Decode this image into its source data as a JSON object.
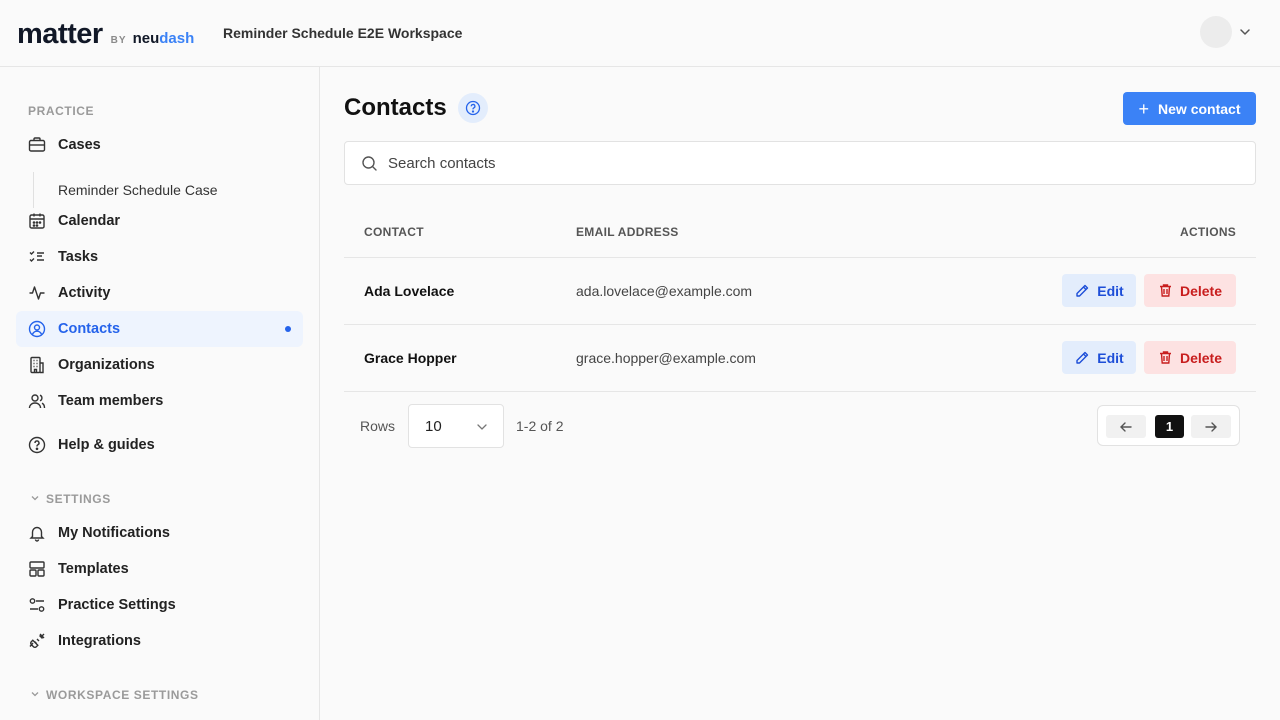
{
  "header": {
    "logo_main": "matter",
    "logo_by": "BY",
    "logo_brand_a": "neu",
    "logo_brand_b": "dash",
    "workspace_name": "Reminder Schedule E2E Workspace"
  },
  "sidebar": {
    "practice_label": "PRACTICE",
    "cases": "Cases",
    "sub_case": "Reminder Schedule Case",
    "calendar": "Calendar",
    "tasks": "Tasks",
    "activity": "Activity",
    "contacts": "Contacts",
    "organizations": "Organizations",
    "team_members": "Team members",
    "help": "Help & guides",
    "settings_label": "SETTINGS",
    "my_notifications": "My Notifications",
    "templates": "Templates",
    "practice_settings": "Practice Settings",
    "integrations": "Integrations",
    "workspace_settings_label": "WORKSPACE SETTINGS"
  },
  "main": {
    "title": "Contacts",
    "new_contact": "New contact",
    "search_placeholder": "Search contacts",
    "columns": {
      "contact": "CONTACT",
      "email": "EMAIL ADDRESS",
      "actions": "ACTIONS"
    },
    "rows": [
      {
        "name": "Ada Lovelace",
        "email": "ada.lovelace@example.com",
        "edit": "Edit",
        "delete": "Delete"
      },
      {
        "name": "Grace Hopper",
        "email": "grace.hopper@example.com",
        "edit": "Edit",
        "delete": "Delete"
      }
    ],
    "pagination": {
      "rows_label": "Rows",
      "rows_value": "10",
      "range": "1-2 of 2",
      "page": "1"
    }
  },
  "colors": {
    "accent": "#3b82f6",
    "active_bg": "#eef4fe",
    "danger_bg": "#fde2e2",
    "danger_text": "#c81e1e"
  }
}
